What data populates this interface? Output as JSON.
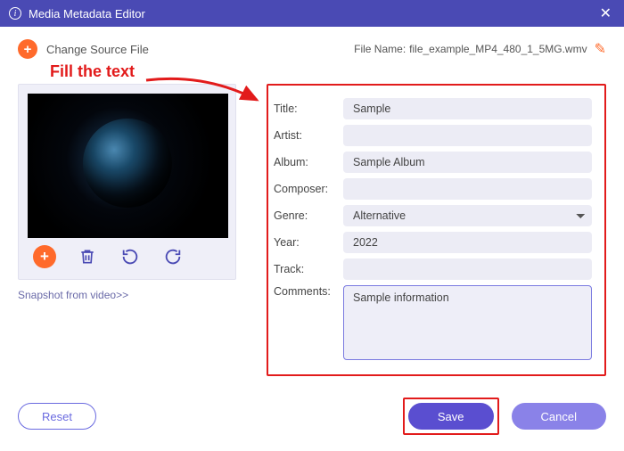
{
  "window": {
    "title": "Media Metadata Editor"
  },
  "top": {
    "change_source_label": "Change Source File",
    "filename_label": "File Name:",
    "filename_value": "file_example_MP4_480_1_5MG.wmv"
  },
  "callout": "Fill the text",
  "snapshot_link": "Snapshot from video>>",
  "fields": {
    "title_label": "Title:",
    "title_value": "Sample",
    "artist_label": "Artist:",
    "artist_value": "",
    "album_label": "Album:",
    "album_value": "Sample Album",
    "composer_label": "Composer:",
    "composer_value": "",
    "genre_label": "Genre:",
    "genre_value": "Alternative",
    "year_label": "Year:",
    "year_value": "2022",
    "track_label": "Track:",
    "track_value": "",
    "comments_label": "Comments:",
    "comments_value": "Sample information"
  },
  "buttons": {
    "reset": "Reset",
    "save": "Save",
    "cancel": "Cancel"
  },
  "icons": {
    "plus": "+",
    "close": "✕",
    "pencil": "✎"
  }
}
